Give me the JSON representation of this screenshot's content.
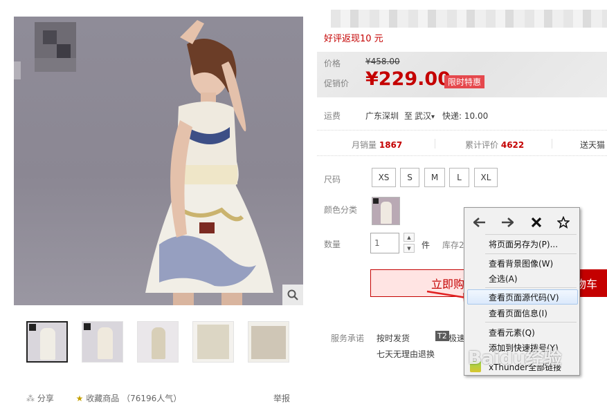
{
  "product": {
    "promo_text": "好评返现10 元",
    "price_label": "价格",
    "original_price": "¥458.00",
    "promo_price_label": "促销价",
    "promo_price": "¥229.00",
    "limited_badge": "限时特惠",
    "shipping_label": "运费",
    "shipping_from": "广东深圳",
    "shipping_to_prefix": "至",
    "shipping_to": "武汉",
    "shipping_fee": "快递: 10.00",
    "stats": {
      "monthly_sales_label": "月销量",
      "monthly_sales": "1867",
      "reviews_label": "累计评价",
      "reviews": "4622",
      "gift_label": "送天猫"
    },
    "size_label": "尺码",
    "sizes": [
      "XS",
      "S",
      "M",
      "L",
      "XL"
    ],
    "color_label": "颜色分类",
    "quantity_label": "数量",
    "quantity_value": "1",
    "quantity_unit": "件",
    "stock_text": "库存2",
    "buy_now": "立即购买",
    "add_to_cart": "购物车",
    "service_label": "服务承诺",
    "service_items": [
      "按时发货",
      "七天无理由退换"
    ],
    "service_t2": "T2",
    "service_fast": "极速"
  },
  "bottom": {
    "share": "分享",
    "favorite": "收藏商品",
    "favorite_count": "（76196人气）",
    "report": "举报"
  },
  "context_menu": {
    "items": [
      {
        "label": "将页面另存为(P)..."
      },
      {
        "label": "查看背景图像(W)"
      },
      {
        "label": "全选(A)"
      },
      {
        "label": "查看页面源代码(V)"
      },
      {
        "label": "查看页面信息(I)"
      },
      {
        "label": "查看元素(Q)"
      },
      {
        "label": "添加到快速拨号(Y)"
      },
      {
        "label": "xThunder全部链接"
      }
    ],
    "nav_icons": [
      "back-arrow-icon",
      "forward-arrow-icon",
      "close-icon",
      "bookmark-star-icon"
    ]
  },
  "watermark": "Baidu经验"
}
